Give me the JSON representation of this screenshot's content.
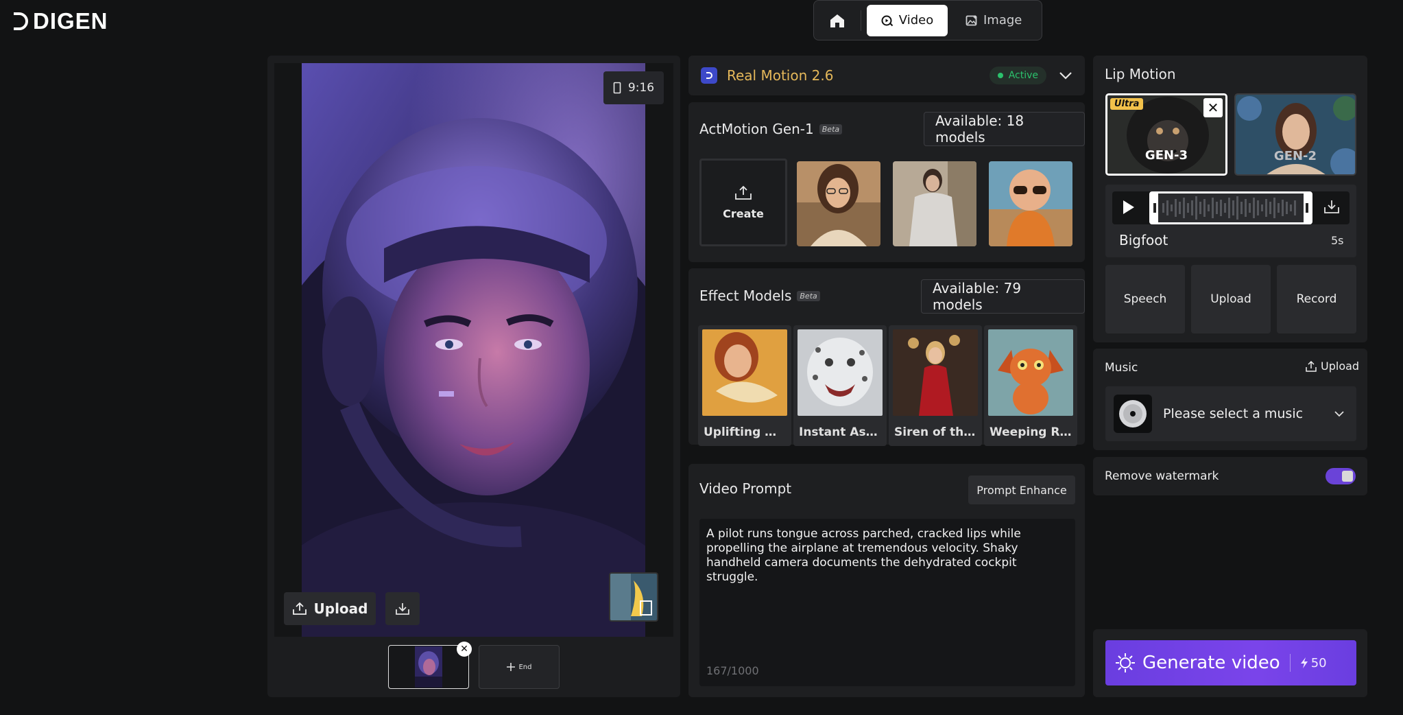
{
  "app": {
    "logo_text": "DIGEN"
  },
  "nav": {
    "video_label": "Video",
    "image_label": "Image"
  },
  "preview": {
    "ratio": "9:16",
    "upload_label": "Upload",
    "end_label": "End"
  },
  "model": {
    "name": "Real Motion 2.6",
    "status": "Active"
  },
  "actmotion": {
    "title": "ActMotion Gen-1",
    "beta": "Beta",
    "available": "Available: 18 models",
    "create_label": "Create"
  },
  "effects": {
    "title": "Effect Models",
    "beta": "Beta",
    "available": "Available: 79 models",
    "items": [
      "Uplifting Ne...",
      "Instant Asc...",
      "Siren of the ...",
      "Weeping Ra..."
    ]
  },
  "prompt": {
    "title": "Video Prompt",
    "enhance_label": "Prompt Enhance",
    "text": "A pilot runs tongue across parched, cracked lips while propelling the airplane at tremendous velocity. Shaky handheld camera documents the dehydrated cockpit struggle.",
    "counter": "167/1000"
  },
  "lip_motion": {
    "title": "Lip Motion",
    "gen3_label": "GEN-3",
    "gen3_badge": "Ultra",
    "gen2_label": "GEN-2",
    "track_name": "Bigfoot",
    "duration": "5s",
    "actions": [
      "Speech",
      "Upload",
      "Record"
    ]
  },
  "music": {
    "title": "Music",
    "upload_label": "Upload",
    "placeholder": "Please select a music"
  },
  "watermark": {
    "label": "Remove watermark",
    "enabled": true
  },
  "generate": {
    "label": "Generate video",
    "cost": "50"
  },
  "colors": {
    "accent": "#7a44ea",
    "model_name": "#e5b85a",
    "active": "#2bc16c",
    "ultra_badge": "#f2c14a"
  }
}
